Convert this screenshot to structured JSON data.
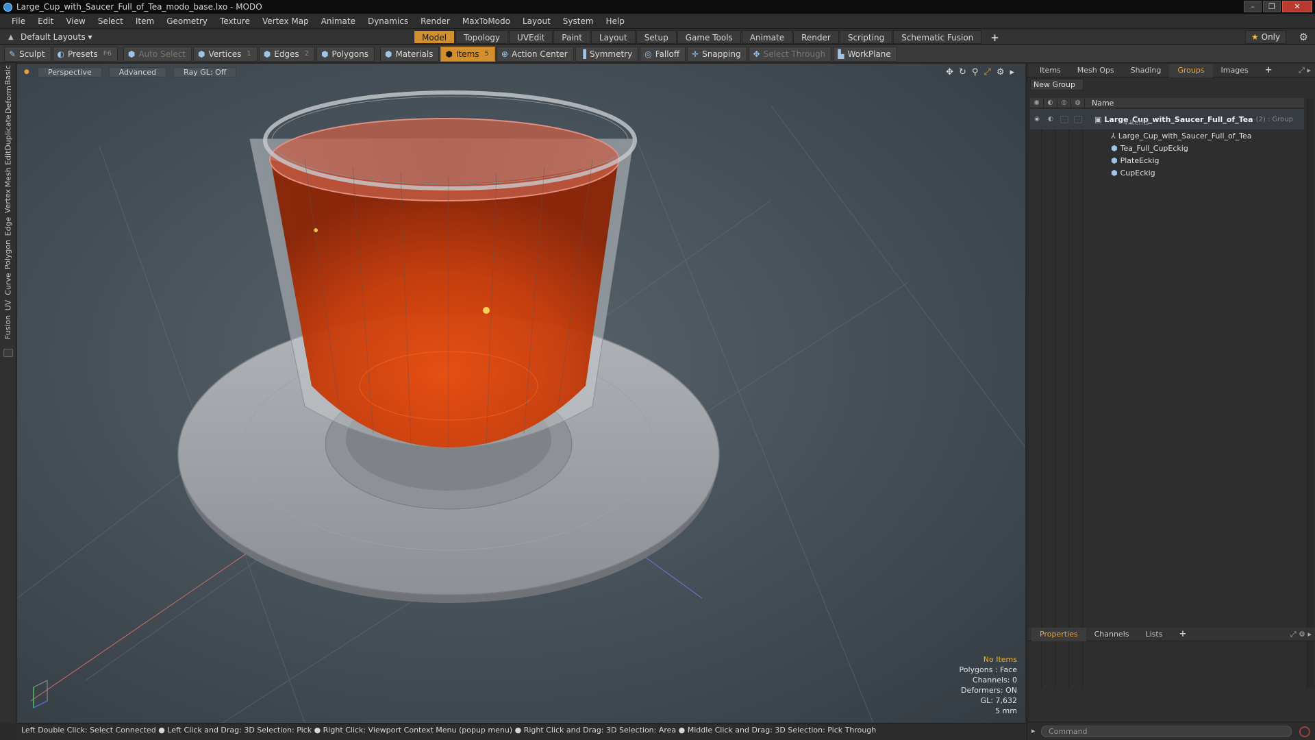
{
  "window": {
    "title": "Large_Cup_with_Saucer_Full_of_Tea_modo_base.lxo - MODO",
    "controls": [
      "–",
      "❐",
      "✕"
    ]
  },
  "menu": [
    "File",
    "Edit",
    "View",
    "Select",
    "Item",
    "Geometry",
    "Texture",
    "Vertex Map",
    "Animate",
    "Dynamics",
    "Render",
    "MaxToModo",
    "Layout",
    "System",
    "Help"
  ],
  "layoutbar": {
    "layout_selector": "Default Layouts ▾",
    "tabs": [
      "Model",
      "Topology",
      "UVEdit",
      "Paint",
      "Layout",
      "Setup",
      "Game Tools",
      "Animate",
      "Render",
      "Scripting",
      "Schematic Fusion"
    ],
    "active_tab": "Model",
    "add": "+",
    "only_label": "Only"
  },
  "toolbar": {
    "sculpt": "Sculpt",
    "presets": "Presets",
    "presets_key": "F6",
    "auto_select": "Auto Select",
    "vertices": "Vertices",
    "vertices_key": "1",
    "edges": "Edges",
    "edges_key": "2",
    "polygons": "Polygons",
    "materials": "Materials",
    "items": "Items",
    "items_key": "5",
    "action_center": "Action Center",
    "symmetry": "Symmetry",
    "falloff": "Falloff",
    "snapping": "Snapping",
    "select_through": "Select Through",
    "workplane": "WorkPlane"
  },
  "left_tabs": [
    "Basic",
    "Deform",
    "Duplicate",
    "Mesh Edit",
    "Vertex",
    "Edge",
    "Polygon",
    "Curve",
    "UV",
    "Fusion"
  ],
  "viewport": {
    "view": "Perspective",
    "shading": "Advanced",
    "raygl": "Ray GL: Off",
    "stats": {
      "selection": "No Items",
      "polygons": "Polygons : Face",
      "channels": "Channels: 0",
      "deformers": "Deformers: ON",
      "gl": "GL: 7,632",
      "unit": "5 mm"
    },
    "colors": {
      "tea": "#c83a08",
      "glass": "#b9bec2",
      "saucer": "#9a9ea2",
      "bg": "#48525a"
    }
  },
  "statusbar": "Left Double Click: Select Connected ● Left Click and Drag: 3D Selection: Pick ● Right Click: Viewport Context Menu (popup menu) ● Right Click and Drag: 3D Selection: Area ● Middle Click and Drag: 3D Selection: Pick Through",
  "right_panel": {
    "tabs": [
      "Items",
      "Mesh Ops",
      "Shading",
      "Groups",
      "Images",
      "+"
    ],
    "active_tab": "Groups",
    "new_group": "New Group",
    "column_name": "Name",
    "group": {
      "name": "Large_Cup_with_Saucer_Full_of_Tea",
      "count": "(2) : Group",
      "subtitle": "4 Items"
    },
    "items": [
      {
        "name": "Large_Cup_with_Saucer_Full_of_Tea",
        "icon": "locator-icon"
      },
      {
        "name": "Tea_Full_CupEckig",
        "icon": "mesh-icon"
      },
      {
        "name": "PlateEckig",
        "icon": "mesh-icon"
      },
      {
        "name": "CupEckig",
        "icon": "mesh-icon"
      }
    ],
    "bottom_tabs": [
      "Properties",
      "Channels",
      "Lists",
      "+"
    ],
    "bottom_active": "Properties",
    "command_placeholder": "Command"
  }
}
